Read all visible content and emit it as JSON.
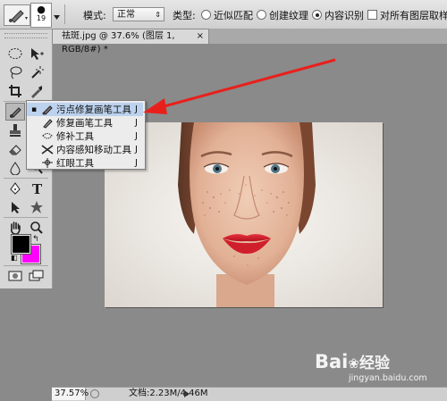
{
  "options_bar": {
    "brush_size": "19",
    "mode_label": "模式:",
    "mode_value": "正常",
    "type_label": "类型:",
    "type_options": [
      "近似匹配",
      "创建纹理",
      "内容识别"
    ],
    "type_selected": 2,
    "sample_all_layers_label": "对所有图层取样",
    "sample_all_layers_checked": false
  },
  "document": {
    "tab_title": "祛斑.jpg @ 37.6% (图层 1, RGB/8#) *",
    "close_glyph": "×"
  },
  "tool_flyout": {
    "items": [
      {
        "label": "污点修复画笔工具",
        "shortcut": "J",
        "icon": "spot-healing-brush-icon",
        "selected": true
      },
      {
        "label": "修复画笔工具",
        "shortcut": "J",
        "icon": "healing-brush-icon",
        "selected": false
      },
      {
        "label": "修补工具",
        "shortcut": "J",
        "icon": "patch-icon",
        "selected": false
      },
      {
        "label": "内容感知移动工具",
        "shortcut": "J",
        "icon": "content-aware-move-icon",
        "selected": false
      },
      {
        "label": "红眼工具",
        "shortcut": "J",
        "icon": "red-eye-icon",
        "selected": false
      }
    ]
  },
  "colors": {
    "foreground": "#000000",
    "background": "#ff00ff",
    "annotation_arrow": "#e8201c",
    "flyout_highlight": "#bcd2ee"
  },
  "status": {
    "zoom": "37.57%",
    "doc_size": "文档:2.23M/4.46M"
  },
  "watermark": {
    "brand": "Bai",
    "brand_tail": "经验",
    "url": "jingyan.baidu.com"
  }
}
